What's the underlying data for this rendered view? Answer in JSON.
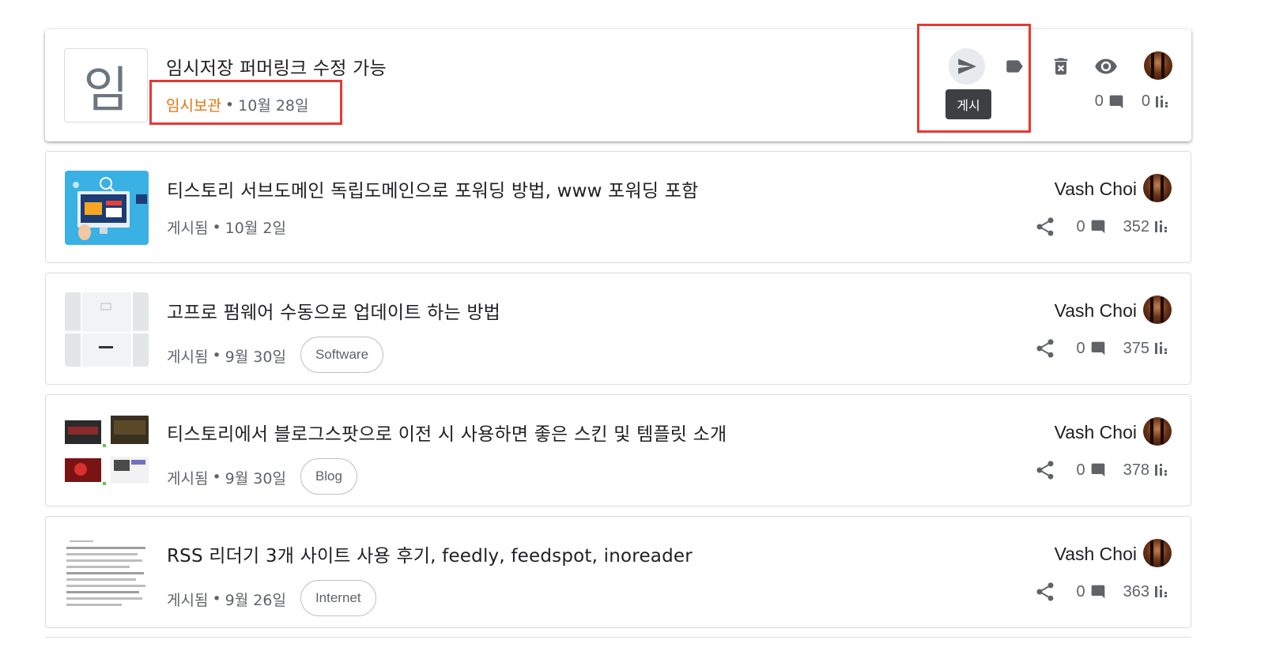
{
  "posts": [
    {
      "thumb_letter": "임",
      "title": "임시저장 퍼머링크 수정 가능",
      "status": "임시보관",
      "date": "10월 28일",
      "comments": "0",
      "views": "0",
      "actions": {
        "publish_icon": "send-icon",
        "label_icon": "label-icon",
        "delete_icon": "delete-icon",
        "preview_icon": "eye-icon"
      },
      "tooltip": "게시"
    },
    {
      "title": "티스토리 서브도메인 독립도메인으로 포워딩 방법, www 포워딩 포함",
      "status": "게시됨",
      "date": "10월 2일",
      "label": "",
      "author": "Vash Choi",
      "comments": "0",
      "views": "352"
    },
    {
      "title": "고프로 펌웨어 수동으로 업데이트 하는 방법",
      "status": "게시됨",
      "date": "9월 30일",
      "label": "Software",
      "author": "Vash Choi",
      "comments": "0",
      "views": "375"
    },
    {
      "title": "티스토리에서 블로그스팟으로 이전 시 사용하면 좋은 스킨 및 템플릿 소개",
      "status": "게시됨",
      "date": "9월 30일",
      "label": "Blog",
      "author": "Vash Choi",
      "comments": "0",
      "views": "378"
    },
    {
      "title": "RSS 리더기 3개 사이트 사용 후기, feedly, feedspot, inoreader",
      "status": "게시됨",
      "date": "9월 26일",
      "label": "Internet",
      "author": "Vash Choi",
      "comments": "0",
      "views": "363"
    }
  ],
  "colors": {
    "draft": "#e8710a",
    "highlight_box": "#e53935",
    "tooltip_bg": "#3c4043",
    "icon": "#5f6368"
  },
  "separator": "•"
}
